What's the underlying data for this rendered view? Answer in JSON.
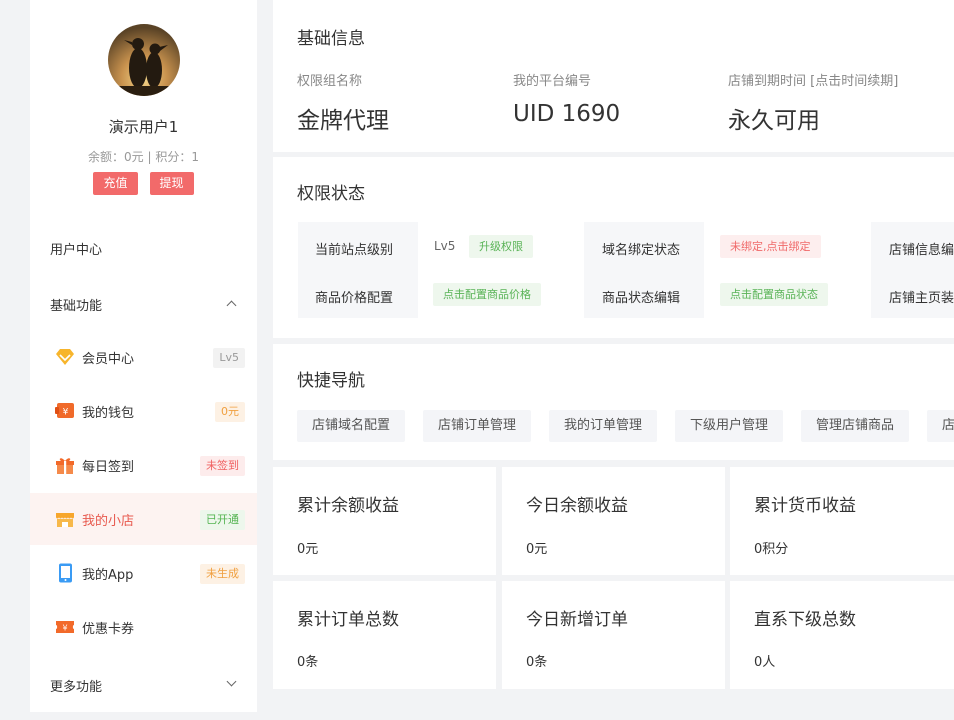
{
  "user": {
    "name": "演示用户1",
    "balance_text": "余额：0元 | 积分：1",
    "recharge_label": "充值",
    "withdraw_label": "提现"
  },
  "sidebar": {
    "user_center": "用户中心",
    "basic_section": "基础功能",
    "more_section": "更多功能",
    "items": [
      {
        "label": "会员中心",
        "badge": "Lv5",
        "icon": "diamond-icon"
      },
      {
        "label": "我的钱包",
        "badge": "0元",
        "icon": "wallet-icon"
      },
      {
        "label": "每日签到",
        "badge": "未签到",
        "icon": "gift-icon"
      },
      {
        "label": "我的小店",
        "badge": "已开通",
        "icon": "shop-icon"
      },
      {
        "label": "我的App",
        "badge": "未生成",
        "icon": "phone-icon"
      },
      {
        "label": "优惠卡券",
        "badge": "",
        "icon": "ticket-icon"
      }
    ]
  },
  "basic_info": {
    "title": "基础信息",
    "group_label": "权限组名称",
    "group_value": "金牌代理",
    "uid_label": "我的平台编号",
    "uid_value": "UID 1690",
    "expire_label": "店铺到期时间 [点击时间续期]",
    "expire_value": "永久可用"
  },
  "perm_status": {
    "title": "权限状态",
    "site_level_label": "当前站点级别",
    "site_level_value": "Lv5",
    "upgrade_tag": "升级权限",
    "price_config_label": "商品价格配置",
    "price_config_tag": "点击配置商品价格",
    "domain_label": "域名绑定状态",
    "domain_tag": "未绑定,点击绑定",
    "goods_status_label": "商品状态编辑",
    "goods_status_tag": "点击配置商品状态",
    "shop_info_label": "店铺信息编",
    "shop_home_label": "店铺主页装"
  },
  "quick_nav": {
    "title": "快捷导航",
    "items": [
      "店铺域名配置",
      "店铺订单管理",
      "我的订单管理",
      "下级用户管理",
      "管理店铺商品",
      "店"
    ]
  },
  "stats": [
    {
      "title": "累计余额收益",
      "value": "0元"
    },
    {
      "title": "今日余额收益",
      "value": "0元"
    },
    {
      "title": "累计货币收益",
      "value": "0积分"
    },
    {
      "title": "累计订单总数",
      "value": "0条"
    },
    {
      "title": "今日新增订单",
      "value": "0条"
    },
    {
      "title": "直系下级总数",
      "value": "0人"
    }
  ],
  "colors": {
    "accent_red": "#f26a6a",
    "active_bg": "#fdf3f1",
    "green": "#54b451",
    "orange": "#f0a040"
  }
}
